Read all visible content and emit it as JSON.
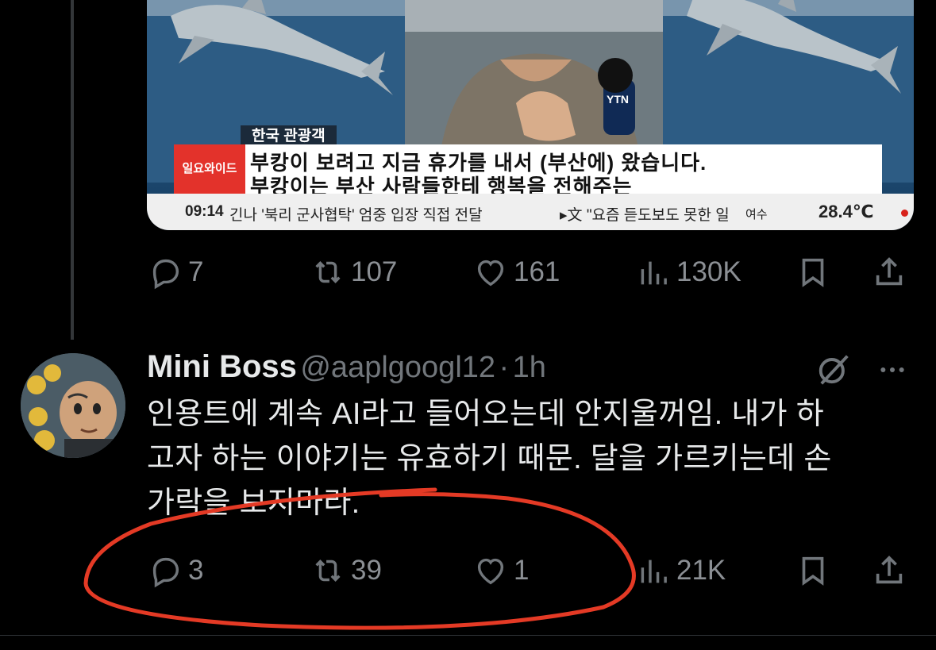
{
  "colors": {
    "background": "#000000",
    "text_primary": "#e7e9ea",
    "text_secondary": "#71767b",
    "annotation_red": "#e43a25"
  },
  "media": {
    "label_small": "한국 관광객",
    "broadcast_logo": "일요와이드",
    "caption_line1": "부캉이 보려고 지금 휴가를 내서 (부산에) 왔습니다.",
    "caption_line2": "부캉이는 부산 사람들한테 행복을 전해주는",
    "ticker_time": "09:14",
    "ticker_headline": "긴나 '북리 군사협탁' 엄중 입장 직접 전달",
    "ticker_headline2": "▸文 \"요즘 듣도보도 못한 일",
    "ticker_city": "여수",
    "ticker_temp": "28.4℃",
    "mic_brand": "YTN"
  },
  "tweet1_actions": {
    "replies": "7",
    "retweets": "107",
    "likes": "161",
    "views": "130K"
  },
  "reply": {
    "name": "Mini Boss",
    "handle": "@aaplgoogl12",
    "separator": "·",
    "time": "1h",
    "text": "인용트에 계속 AI라고 들어오는데 안지울꺼임. 내가 하\n고자 하는 이야기는 유효하기 때문. 달을 가르키는데 손\n가락을 보지마라."
  },
  "reply_actions": {
    "replies": "3",
    "retweets": "39",
    "likes": "1",
    "views": "21K"
  },
  "icons": [
    "reply-icon",
    "retweet-icon",
    "like-icon",
    "views-icon",
    "bookmark-icon",
    "share-icon",
    "grok-icon",
    "more-icon"
  ]
}
